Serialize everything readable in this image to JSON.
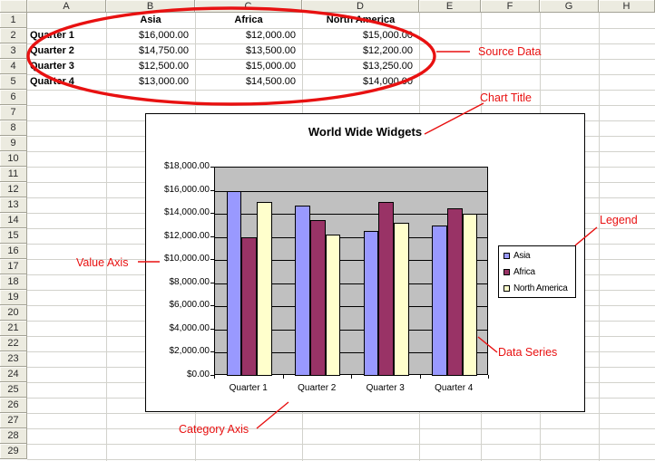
{
  "app": {
    "type": "spreadsheet-worksheet"
  },
  "spreadsheet": {
    "column_labels": [
      "A",
      "B",
      "C",
      "D",
      "E",
      "F",
      "G",
      "H"
    ],
    "row_count": 29,
    "table": {
      "column_headers": [
        "Asia",
        "Africa",
        "North America"
      ],
      "row_header_labels": [
        "Quarter 1",
        "Quarter 2",
        "Quarter 3",
        "Quarter 4"
      ],
      "values": [
        [
          "$16,000.00",
          "$12,000.00",
          "$15,000.00"
        ],
        [
          "$14,750.00",
          "$13,500.00",
          "$12,200.00"
        ],
        [
          "$12,500.00",
          "$15,000.00",
          "$13,250.00"
        ],
        [
          "$13,000.00",
          "$14,500.00",
          "$14,000.00"
        ]
      ]
    }
  },
  "chart_data": {
    "type": "bar",
    "title": "World Wide Widgets",
    "categories": [
      "Quarter 1",
      "Quarter 2",
      "Quarter 3",
      "Quarter 4"
    ],
    "series": [
      {
        "name": "Asia",
        "color": "#9999FF",
        "values": [
          16000,
          14750,
          12500,
          13000
        ]
      },
      {
        "name": "Africa",
        "color": "#993366",
        "values": [
          12000,
          13500,
          15000,
          14500
        ]
      },
      {
        "name": "North America",
        "color": "#FFFFCC",
        "values": [
          15000,
          12200,
          13250,
          14000
        ]
      }
    ],
    "ylim": [
      0,
      18000
    ],
    "ytick_step": 2000,
    "ytick_labels": [
      "$0.00",
      "$2,000.00",
      "$4,000.00",
      "$6,000.00",
      "$8,000.00",
      "$10,000.00",
      "$12,000.00",
      "$14,000.00",
      "$16,000.00",
      "$18,000.00"
    ],
    "xlabel": "",
    "ylabel": "",
    "grid": true,
    "legend_position": "right",
    "plot_background": "#C0C0C0"
  },
  "annotations": {
    "color": "#E81111",
    "labels": [
      {
        "id": "source-data",
        "text": "Source Data"
      },
      {
        "id": "chart-title",
        "text": "Chart Title"
      },
      {
        "id": "legend",
        "text": "Legend"
      },
      {
        "id": "value-axis",
        "text": "Value Axis"
      },
      {
        "id": "data-series",
        "text": "Data Series"
      },
      {
        "id": "category-axis",
        "text": "Category Axis"
      }
    ]
  }
}
